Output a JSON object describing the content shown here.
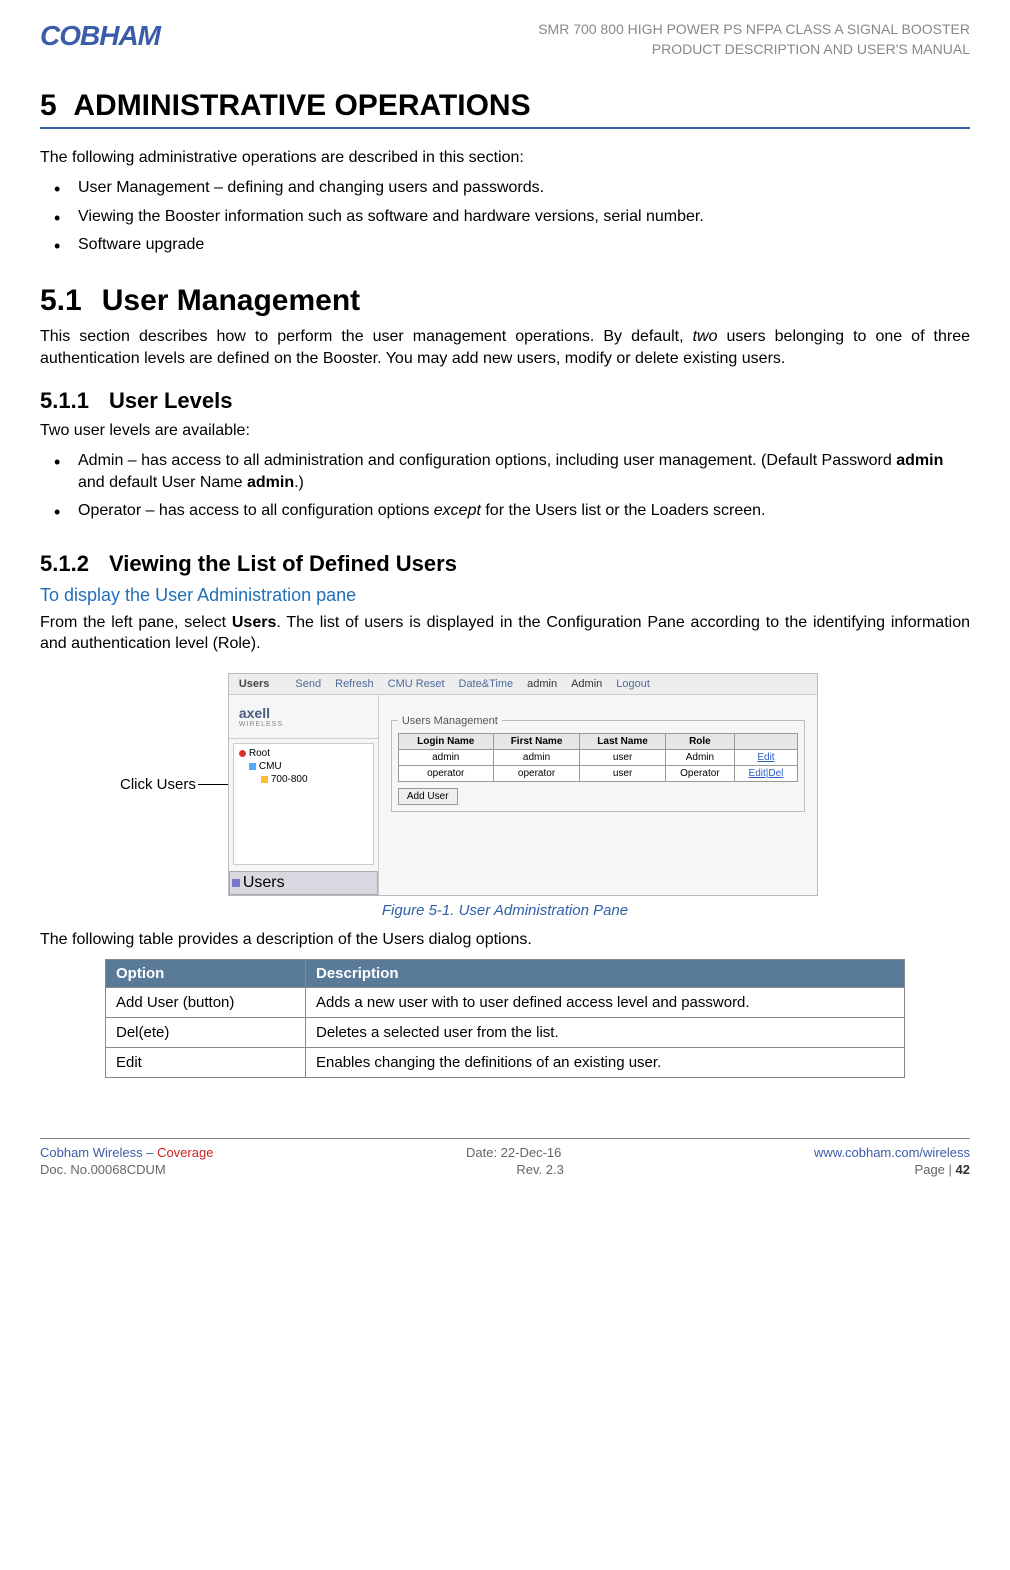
{
  "header": {
    "logo_text": "COBHAM",
    "line1": "SMR 700 800 HIGH POWER PS NFPA CLASS A SIGNAL BOOSTER",
    "line2": "PRODUCT DESCRIPTION AND USER'S MANUAL"
  },
  "chapter": {
    "number": "5",
    "title": "ADMINISTRATIVE OPERATIONS"
  },
  "intro": "The following administrative operations are described in this section:",
  "intro_bullets": [
    "User Management – defining and changing users and passwords.",
    "Viewing the Booster information such as software and hardware versions, serial number.",
    "Software upgrade"
  ],
  "s51": {
    "number": "5.1",
    "title": "User Management",
    "body_pre": "This section describes how to perform the user management operations. By default, ",
    "body_italic": "two",
    "body_post": " users belonging to one of three authentication levels are defined on the Booster. You may add new users, modify or delete existing users."
  },
  "s511": {
    "number": "5.1.1",
    "title": "User Levels",
    "intro": "Two user levels are available:",
    "bullet1_pre": "Admin – has access to all administration and configuration options, including user management. (Default Password ",
    "bullet1_b1": "admin",
    "bullet1_mid": " and default User Name ",
    "bullet1_b2": "admin",
    "bullet1_post": ".)",
    "bullet2_pre": "Operator – has access to all configuration options ",
    "bullet2_italic": "except",
    "bullet2_post": " for the Users list or the Loaders screen."
  },
  "s512": {
    "number": "5.1.2",
    "title": "Viewing the List of Defined Users",
    "bluehead": "To display the User Administration pane",
    "para_pre": "From the left pane, select ",
    "para_bold": "Users",
    "para_post": ". The list of users is displayed in the Configuration Pane according to the identifying information and authentication level (Role)."
  },
  "click_label": "Click Users",
  "mock": {
    "toolbar": {
      "title": "Users",
      "items": [
        "Send",
        "Refresh",
        "CMU Reset",
        "Date&Time",
        "admin",
        "Admin",
        "Logout"
      ]
    },
    "brand": "axell",
    "brand_sub": "WIRELESS",
    "tree": {
      "root": "Root",
      "cmu": "CMU",
      "band": "700-800",
      "users": "Users"
    },
    "legend": "Users Management",
    "headers": [
      "Login Name",
      "First Name",
      "Last Name",
      "Role",
      ""
    ],
    "rows": [
      {
        "login": "admin",
        "first": "admin",
        "last": "user",
        "role": "Admin",
        "actions": "Edit"
      },
      {
        "login": "operator",
        "first": "operator",
        "last": "user",
        "role": "Operator",
        "actions": "Edit|Del"
      }
    ],
    "add_button": "Add User"
  },
  "figure_caption": "Figure 5-1. User Administration Pane",
  "table_intro": "The following table provides a description of the Users dialog options.",
  "options": {
    "h1": "Option",
    "h2": "Description",
    "rows": [
      {
        "opt": "Add User (button)",
        "desc": "Adds a new user with to user defined access level and password."
      },
      {
        "opt": "Del(ete)",
        "desc": "Deletes a selected user from the list."
      },
      {
        "opt": "Edit",
        "desc": "Enables changing the definitions of an existing user."
      }
    ]
  },
  "footer": {
    "brand": "Cobham Wireless",
    "dash": " – ",
    "tag": "Coverage",
    "date": "Date: 22-Dec-16",
    "url": "www.cobham.com/wireless",
    "doc": "Doc. No.00068CDUM",
    "rev": "Rev. 2.3",
    "page_label": "Page | ",
    "page_num": "42"
  }
}
